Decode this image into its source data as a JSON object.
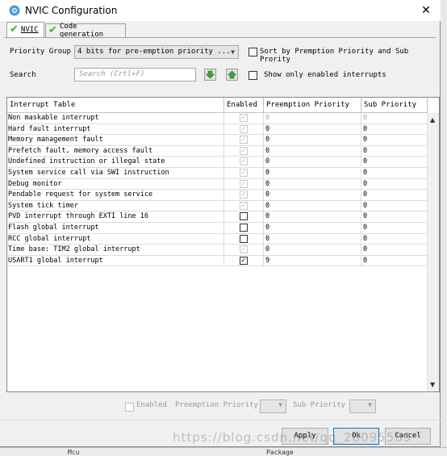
{
  "window": {
    "title": "NVIC Configuration",
    "close": "✕"
  },
  "tabs": [
    {
      "label": "NVIC"
    },
    {
      "label": "Code generation"
    }
  ],
  "priority_group": {
    "label": "Priority Group",
    "value": "4 bits for pre-emption priority ..."
  },
  "sort_option": {
    "label": "Sort by Premption Priority and Sub Prority",
    "checked": false
  },
  "search": {
    "label": "Search",
    "placeholder": "Search (Crtl+F)"
  },
  "show_enabled": {
    "label": "Show only enabled interrupts",
    "checked": false
  },
  "table": {
    "columns": [
      "Interrupt Table",
      "Enabled",
      "Preemption Priority",
      "Sub Priority"
    ],
    "rows": [
      {
        "name": "Non maskable interrupt",
        "enabled": true,
        "locked": true,
        "preemption": "0",
        "sub": "0"
      },
      {
        "name": "Hard fault interrupt",
        "enabled": true,
        "locked": true,
        "preemption": "0",
        "sub": "0"
      },
      {
        "name": "Memory management fault",
        "enabled": true,
        "locked": true,
        "preemption": "0",
        "sub": "0"
      },
      {
        "name": "Prefetch fault, memory access fault",
        "enabled": true,
        "locked": true,
        "preemption": "0",
        "sub": "0"
      },
      {
        "name": "Undefined instruction or illegal state",
        "enabled": true,
        "locked": true,
        "preemption": "0",
        "sub": "0"
      },
      {
        "name": "System service call via SWI instruction",
        "enabled": true,
        "locked": true,
        "preemption": "0",
        "sub": "0"
      },
      {
        "name": "Debug monitor",
        "enabled": true,
        "locked": true,
        "preemption": "0",
        "sub": "0"
      },
      {
        "name": "Pendable request for system service",
        "enabled": true,
        "locked": true,
        "preemption": "0",
        "sub": "0"
      },
      {
        "name": "System tick timer",
        "enabled": true,
        "locked": true,
        "preemption": "0",
        "sub": "0"
      },
      {
        "name": "PVD interrupt through EXTI line 16",
        "enabled": false,
        "locked": false,
        "preemption": "0",
        "sub": "0"
      },
      {
        "name": "Flash global interrupt",
        "enabled": false,
        "locked": false,
        "preemption": "0",
        "sub": "0"
      },
      {
        "name": "RCC global interrupt",
        "enabled": false,
        "locked": false,
        "preemption": "0",
        "sub": "0"
      },
      {
        "name": "Time base: TIM2 global interrupt",
        "enabled": true,
        "locked": true,
        "preemption": "0",
        "sub": "0"
      },
      {
        "name": "USART1 global interrupt",
        "enabled": true,
        "locked": false,
        "preemption": "9",
        "sub": "0"
      }
    ]
  },
  "bottom": {
    "enabled_label": "Enabled",
    "preemption_label": "Preemption Priority",
    "sub_label": "Sub Priority"
  },
  "buttons": {
    "apply": "Apply",
    "ok": "Ok",
    "cancel": "Cancel"
  },
  "watermark": "https://blog.csdn.net/qq_28095569",
  "background": {
    "mcu_label": "Mcu",
    "package_label": "Package"
  },
  "colors": {
    "check_green": "#3cab3c",
    "default_button_border": "#0078d7",
    "desktop_blue": "#3a7dc9"
  }
}
